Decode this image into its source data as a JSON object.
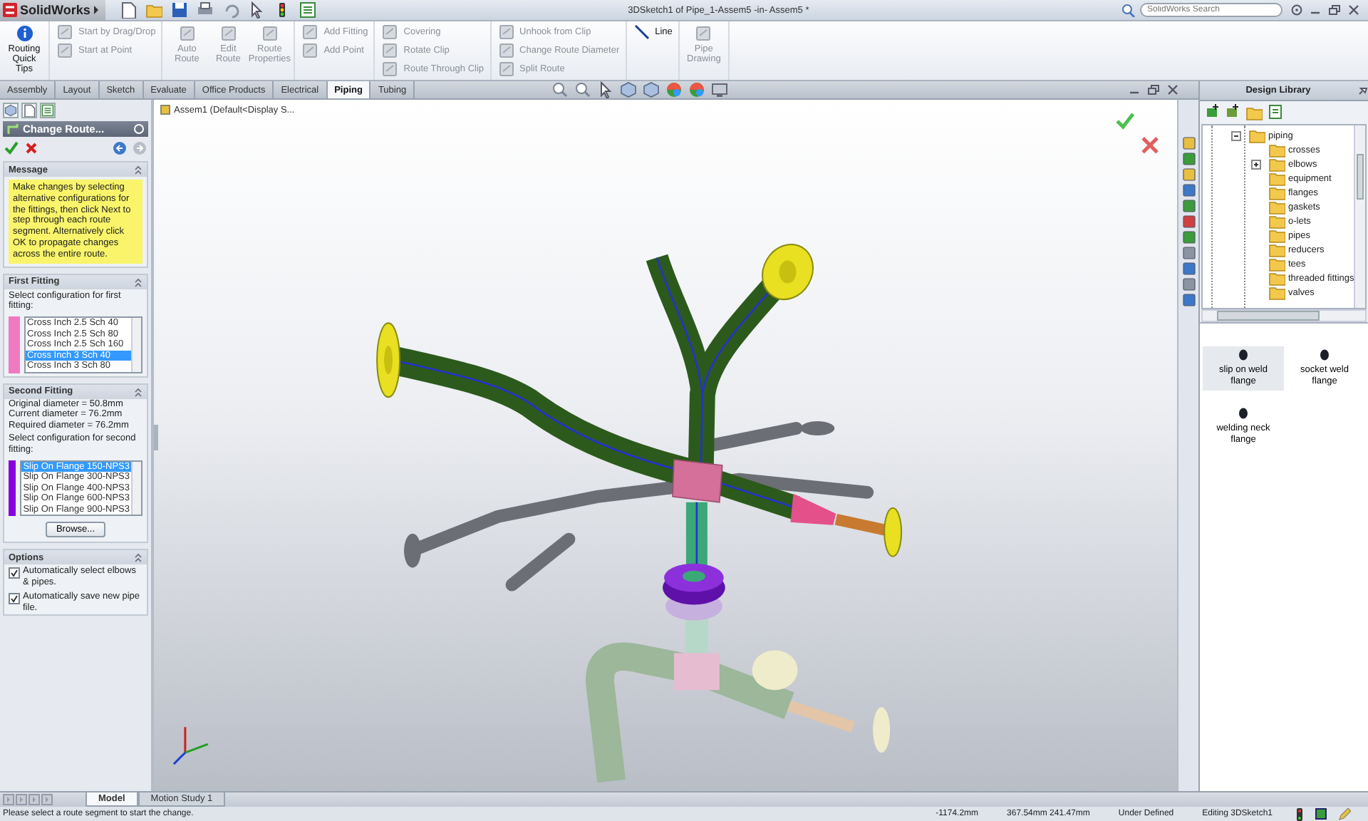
{
  "window": {
    "app_name": "SolidWorks",
    "title": "3DSketch1 of Pipe_1-Assem5 -in- Assem5 *",
    "search": {
      "placeholder": "SolidWorks Search"
    }
  },
  "ribbon": [
    {
      "kind": "large",
      "items": [
        {
          "label": "Routing Quick Tips",
          "disabled": false
        }
      ]
    },
    {
      "kind": "stack",
      "items": [
        {
          "label": "Start by Drag/Drop",
          "disabled": true
        },
        {
          "label": "Start at Point",
          "disabled": true
        }
      ]
    },
    {
      "kind": "large",
      "items": [
        {
          "label": "Auto Route",
          "disabled": true
        },
        {
          "label": "Edit Route",
          "disabled": true
        },
        {
          "label": "Route Properties",
          "disabled": true
        }
      ]
    },
    {
      "kind": "stack",
      "items": [
        {
          "label": "Add Fitting",
          "disabled": true
        },
        {
          "label": "Add Point",
          "disabled": true
        }
      ]
    },
    {
      "kind": "stack",
      "items": [
        {
          "label": "Covering",
          "disabled": true
        },
        {
          "label": "Rotate Clip",
          "disabled": true
        },
        {
          "label": "Route Through Clip",
          "disabled": true
        }
      ]
    },
    {
      "kind": "stack",
      "items": [
        {
          "label": "Unhook from Clip",
          "disabled": true
        },
        {
          "label": "Change Route Diameter",
          "disabled": true
        },
        {
          "label": "Split Route",
          "disabled": true
        }
      ]
    },
    {
      "kind": "stack",
      "items": [
        {
          "label": "Line",
          "disabled": false
        }
      ]
    },
    {
      "kind": "large",
      "items": [
        {
          "label": "Pipe Drawing",
          "disabled": true
        }
      ]
    }
  ],
  "tabs": [
    {
      "label": "Assembly",
      "selected": false
    },
    {
      "label": "Layout",
      "selected": false
    },
    {
      "label": "Sketch",
      "selected": false
    },
    {
      "label": "Evaluate",
      "selected": false
    },
    {
      "label": "Office Products",
      "selected": false
    },
    {
      "label": "Electrical",
      "selected": false
    },
    {
      "label": "Piping",
      "selected": true
    },
    {
      "label": "Tubing",
      "selected": false
    }
  ],
  "property_manager": {
    "title": "Change Route...",
    "sections": [
      {
        "kind": "message",
        "title": "Message",
        "text": "Make changes by selecting alternative configurations for the fittings, then click Next to step through each route segment. Alternatively click OK to propagate changes across the entire route."
      },
      {
        "kind": "fitting",
        "title": "First Fitting",
        "prompt": "Select configuration for first fitting:",
        "color": "#f07ac0",
        "options": [
          {
            "label": "Cross Inch 2.5 Sch 40",
            "selected": false
          },
          {
            "label": "Cross Inch 2.5 Sch 80",
            "selected": false
          },
          {
            "label": "Cross Inch 2.5 Sch 160",
            "selected": false
          },
          {
            "label": "Cross Inch 3 Sch 40",
            "selected": true
          },
          {
            "label": "Cross Inch 3 Sch 80",
            "selected": false
          }
        ]
      },
      {
        "kind": "fitting",
        "title": "Second Fitting",
        "info": [
          "Original diameter = 50.8mm",
          "Current diameter = 76.2mm",
          "Required diameter = 76.2mm"
        ],
        "prompt": "Select configuration for second fitting:",
        "color": "#8800dd",
        "options": [
          {
            "label": "Slip On Flange 150-NPS3",
            "selected": true
          },
          {
            "label": "Slip On Flange 300-NPS3",
            "selected": false
          },
          {
            "label": "Slip On Flange 400-NPS3",
            "selected": false
          },
          {
            "label": "Slip On Flange 600-NPS3",
            "selected": false
          },
          {
            "label": "Slip On Flange 900-NPS3",
            "selected": false
          }
        ],
        "button": "Browse..."
      },
      {
        "kind": "options",
        "title": "Options",
        "checkboxes": [
          {
            "label": "Automatically select elbows & pipes.",
            "checked": true
          },
          {
            "label": "Automatically save new pipe file.",
            "checked": true
          }
        ]
      }
    ]
  },
  "viewport": {
    "label": "Assem1 (Default<Display S..."
  },
  "design_library": {
    "title": "Design Library",
    "tree": [
      {
        "label": "piping",
        "expanded": true,
        "children": [
          {
            "label": "crosses",
            "expandable": false
          },
          {
            "label": "elbows",
            "expandable": true
          },
          {
            "label": "equipment",
            "expandable": false
          },
          {
            "label": "flanges",
            "expandable": false
          },
          {
            "label": "gaskets",
            "expandable": false
          },
          {
            "label": "o-lets",
            "expandable": false
          },
          {
            "label": "pipes",
            "expandable": false
          },
          {
            "label": "reducers",
            "expandable": false
          },
          {
            "label": "tees",
            "expandable": false
          },
          {
            "label": "threaded fittings",
            "expandable": false
          },
          {
            "label": "valves",
            "expandable": false
          }
        ]
      }
    ],
    "items": [
      {
        "label": "slip on weld flange",
        "selected": true
      },
      {
        "label": "socket weld flange",
        "selected": false
      },
      {
        "label": "welding neck flange",
        "selected": false
      }
    ]
  },
  "bottom_tabs": [
    {
      "label": "Model",
      "selected": true
    },
    {
      "label": "Motion Study 1",
      "selected": false
    }
  ],
  "status_bar": {
    "message": "Please select a route segment to start the change.",
    "fields": [
      "-1174.2mm",
      "367.54mm 241.47mm",
      "Under Defined",
      "Editing 3DSketch1"
    ]
  }
}
